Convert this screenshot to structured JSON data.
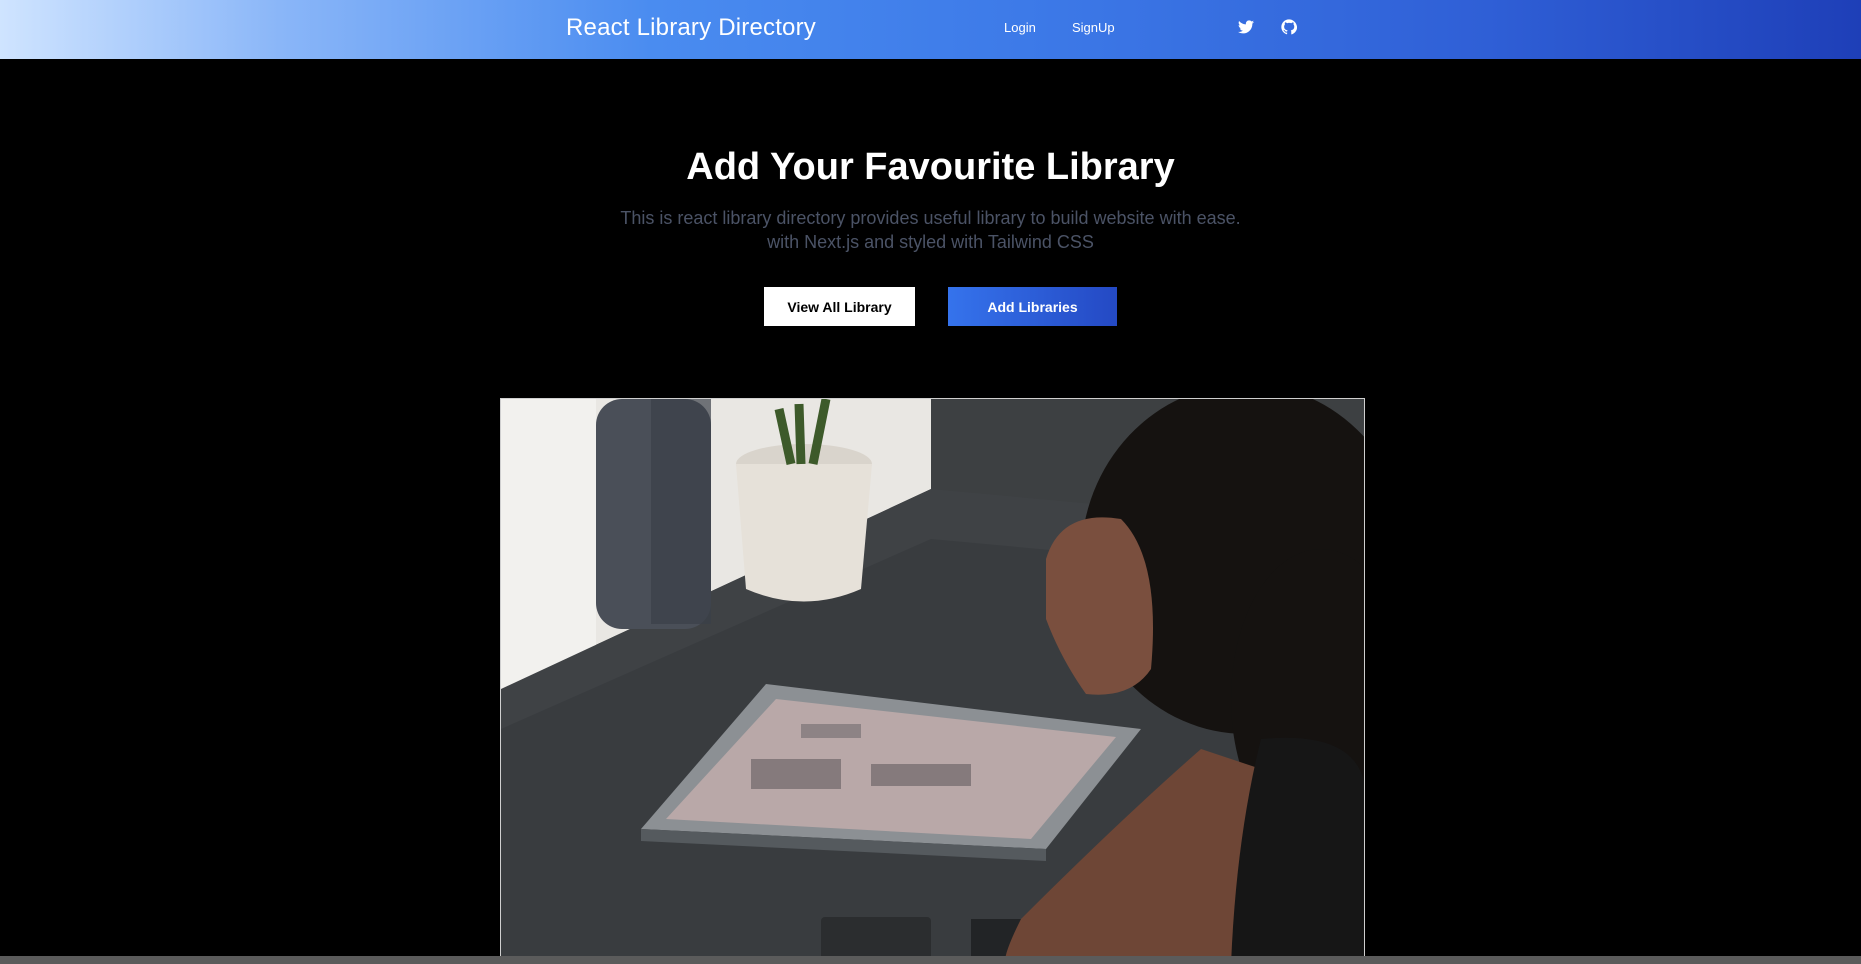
{
  "navbar": {
    "brand": "React Library Directory",
    "links": {
      "login": "Login",
      "signup": "SignUp"
    },
    "icons": {
      "twitter": "twitter-icon",
      "github": "github-icon"
    }
  },
  "hero": {
    "title": "Add Your Favourite Library",
    "subtitle_line1": "This is react library directory provides useful library to build website with ease.",
    "subtitle_line2": "with Next.js and styled with Tailwind CSS",
    "buttons": {
      "view_all": "View All Library",
      "add": "Add Libraries"
    }
  },
  "colors": {
    "background": "#000000",
    "accent": "#2f5fd6",
    "subtitle": "#4b5366"
  },
  "image": {
    "subject": "person repairing laptop on desk"
  }
}
